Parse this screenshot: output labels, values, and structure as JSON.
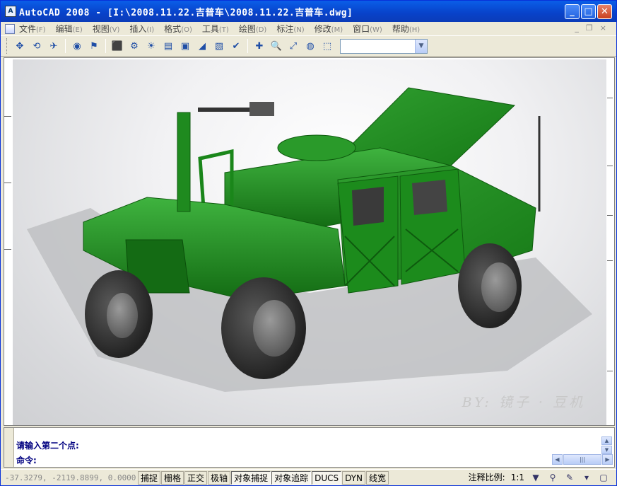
{
  "window": {
    "app_icon": "A",
    "title": "AutoCAD 2008 - [I:\\2008.11.22.吉普车\\2008.11.22.吉普车.dwg]",
    "controls": {
      "minimize": "_",
      "maximize": "□",
      "close": "✕"
    }
  },
  "menu": {
    "items": [
      {
        "label": "文件",
        "acc": "(F)"
      },
      {
        "label": "编辑",
        "acc": "(E)"
      },
      {
        "label": "视图",
        "acc": "(V)"
      },
      {
        "label": "插入",
        "acc": "(I)"
      },
      {
        "label": "格式",
        "acc": "(O)"
      },
      {
        "label": "工具",
        "acc": "(T)"
      },
      {
        "label": "绘图",
        "acc": "(D)"
      },
      {
        "label": "标注",
        "acc": "(N)"
      },
      {
        "label": "修改",
        "acc": "(M)"
      },
      {
        "label": "窗口",
        "acc": "(W)"
      },
      {
        "label": "帮助",
        "acc": "(H)"
      }
    ],
    "mdi": {
      "minimize": "_",
      "restore": "❐",
      "close": "×"
    }
  },
  "toolbar": {
    "icons": [
      "pan-icon",
      "orbit-icon",
      "free-orbit-icon",
      "camera-icon",
      "walk-icon",
      "box-icon",
      "render-icon",
      "light-icon",
      "material-icon",
      "render-window-icon",
      "environment-icon",
      "render-setup-icon",
      "check-icon",
      "zoom-realtime-icon",
      "zoom-window-icon",
      "zoom-previous-icon",
      "named-view-icon",
      "zoom-extents-icon"
    ],
    "glyphs": [
      "✥",
      "⟲",
      "✈",
      "◉",
      "⚑",
      "⬛",
      "⚙",
      "☀",
      "▤",
      "▣",
      "◢",
      "▧",
      "✔",
      "✚",
      "🔍",
      "⤢",
      "◍",
      "⬚"
    ],
    "combo_value": "",
    "combo_arrow": "▼"
  },
  "viewport": {
    "watermark": "BY: 镜子 · 豆机",
    "colors": {
      "body": "#1f8a1f",
      "tire": "#3a3a3a",
      "shadow": "#b8b9bc"
    }
  },
  "command": {
    "line1": "请输入第二个点:",
    "line2": "命令:",
    "scroll_up": "▲",
    "scroll_down": "▼",
    "hscroll_left": "◀",
    "hscroll_thumb": "|||",
    "hscroll_right": "▶"
  },
  "status": {
    "coords": "-37.3279, -2119.8899, 0.0000",
    "buttons": [
      {
        "label": "捕捉",
        "on": false
      },
      {
        "label": "栅格",
        "on": false
      },
      {
        "label": "正交",
        "on": false
      },
      {
        "label": "极轴",
        "on": false
      },
      {
        "label": "对象捕捉",
        "on": true
      },
      {
        "label": "对象追踪",
        "on": true
      },
      {
        "label": "DUCS",
        "on": true
      },
      {
        "label": "DYN",
        "on": false
      },
      {
        "label": "线宽",
        "on": false
      }
    ],
    "annotation_scale_label": "注释比例:",
    "annotation_scale_value": "1:1",
    "right_icons": [
      "▼",
      "⚲",
      "✎",
      "▾",
      "▢"
    ]
  }
}
